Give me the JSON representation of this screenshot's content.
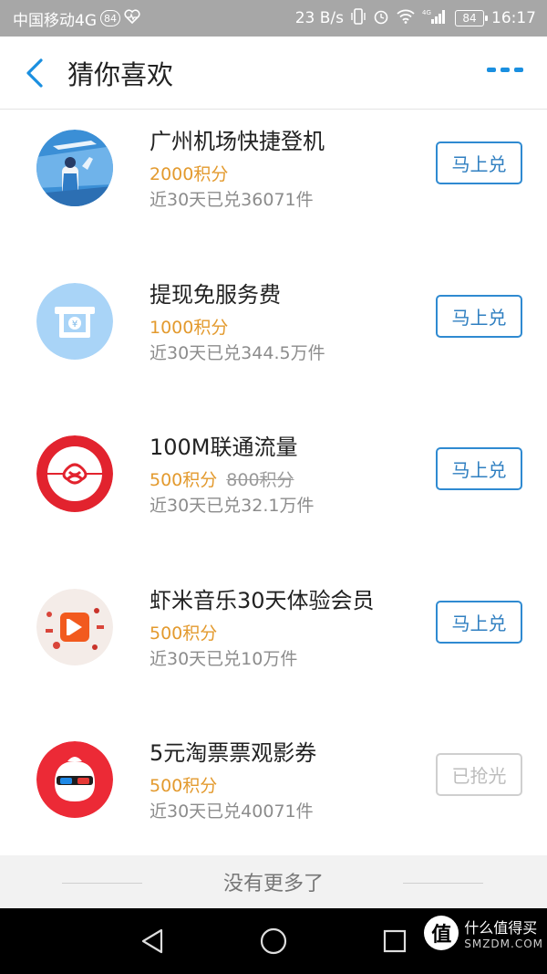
{
  "status_bar": {
    "carrier": "中国移动4G",
    "carrier_badge": "84",
    "speed": "23 B/s",
    "battery": "84",
    "time": "16:17",
    "signal_label": "4G"
  },
  "header": {
    "title": "猜你喜欢",
    "back_icon": "chevron-left-icon",
    "more_icon": "more-dots-icon",
    "accent_color": "#1a8fe0"
  },
  "items": [
    {
      "title": "广州机场快捷登机",
      "points": "2000积分",
      "original_points": "",
      "stats": "近30天已兑36071件",
      "button": "马上兑",
      "button_enabled": true,
      "icon": "airport-boarding-icon"
    },
    {
      "title": "提现免服务费",
      "points": "1000积分",
      "original_points": "",
      "stats": "近30天已兑344.5万件",
      "button": "马上兑",
      "button_enabled": true,
      "icon": "atm-yuan-icon"
    },
    {
      "title": "100M联通流量",
      "points": "500积分",
      "original_points": "800积分",
      "stats": "近30天已兑32.1万件",
      "button": "马上兑",
      "button_enabled": true,
      "icon": "china-unicom-icon"
    },
    {
      "title": "虾米音乐30天体验会员",
      "points": "500积分",
      "original_points": "",
      "stats": "近30天已兑10万件",
      "button": "马上兑",
      "button_enabled": true,
      "icon": "xiami-music-icon"
    },
    {
      "title": "5元淘票票观影券",
      "points": "500积分",
      "original_points": "",
      "stats": "近30天已兑40071件",
      "button": "已抢光",
      "button_enabled": false,
      "icon": "taopiaopiao-icon"
    }
  ],
  "footer": {
    "text": "没有更多了"
  },
  "watermark": {
    "logo": "值",
    "cn": "什么值得买",
    "en": "SMZDM.COM"
  },
  "colors": {
    "points": "#e39a2e",
    "button_border": "#2f8ad1",
    "button_disabled": "#cfcfcf"
  }
}
